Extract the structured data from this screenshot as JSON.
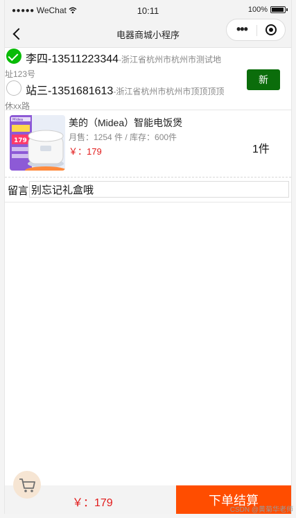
{
  "status_bar": {
    "carrier": "WeChat",
    "time": "10:11",
    "battery": "100%"
  },
  "nav": {
    "title": "电器商城小程序"
  },
  "addresses": [
    {
      "name_phone": "李四-13511223344",
      "detail": "-浙江省杭州市杭州市测试地",
      "detail_cont": "址123号",
      "selected": true
    },
    {
      "name_phone": "站三-1351681613",
      "detail": "-浙江省杭州市杭州市顶顶顶顶",
      "detail_cont": "休xx路",
      "selected": false
    }
  ],
  "new_button": "新",
  "product": {
    "title": "美的（Midea）智能电饭煲",
    "meta": "月售：1254 件 / 库存：600件",
    "price": "￥：179",
    "quantity": "1件",
    "thumb": {
      "brand": "Midea",
      "badge": "179"
    }
  },
  "message": {
    "label": "留言",
    "value": "别忘记礼盒哦"
  },
  "bottom": {
    "total": "￥：179",
    "checkout_label": "下单结算"
  },
  "watermark": "CSDN @黄菊华老师",
  "colors": {
    "accent_green": "#09bb07",
    "new_button": "#0b6d0b",
    "checkout": "#ff4d00",
    "price_red": "#e21b1b"
  }
}
